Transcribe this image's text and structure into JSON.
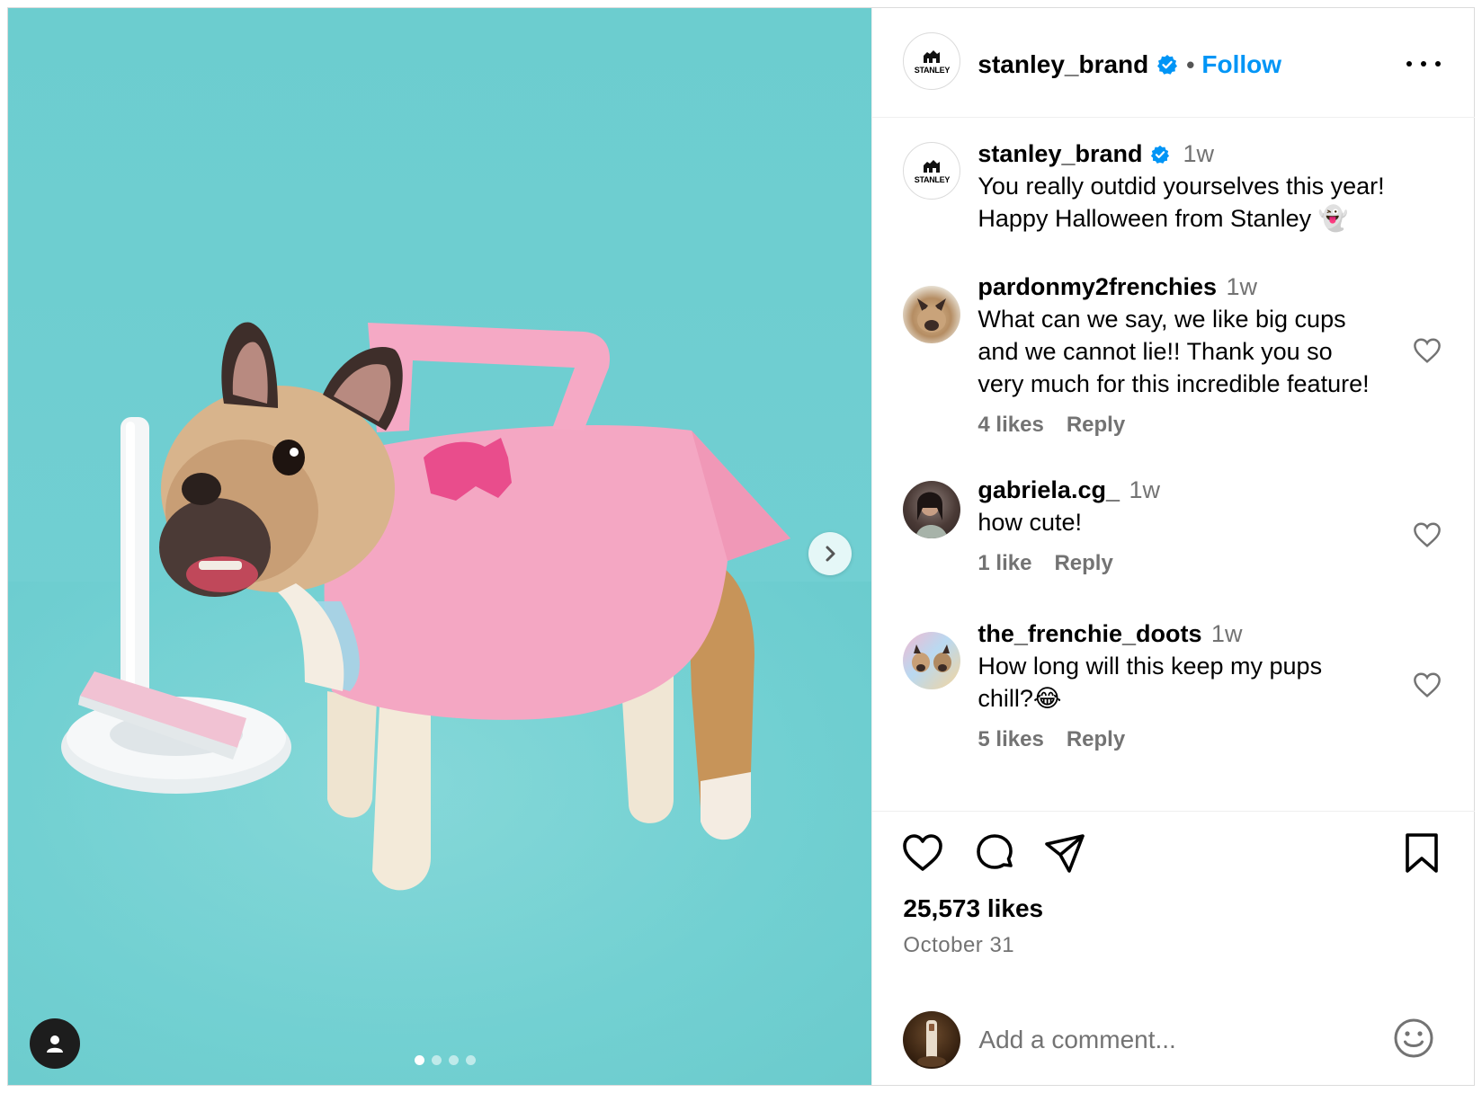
{
  "post": {
    "account": {
      "username": "stanley_brand",
      "verified": true,
      "follow_label": "Follow",
      "dot": "•",
      "avatar_logo_text": "STANLEY"
    },
    "media": {
      "description_icon": "user-tag-icon",
      "carousel_count": 4,
      "carousel_active_index": 0
    },
    "caption": {
      "username": "stanley_brand",
      "time": "1w",
      "line1": "You really outdid yourselves this year!",
      "line2": "Happy Halloween from Stanley 👻"
    },
    "comments": [
      {
        "username": "pardonmy2frenchies",
        "time": "1w",
        "lines": [
          "What can we say, we like big cups",
          "and we cannot lie!! Thank you so",
          "very much for this incredible feature!"
        ],
        "likes": "4 likes",
        "reply": "Reply"
      },
      {
        "username": "gabriela.cg_",
        "time": "1w",
        "lines": [
          "how cute!"
        ],
        "likes": "1 like",
        "reply": "Reply"
      },
      {
        "username": "the_frenchie_doots",
        "time": "1w",
        "lines": [
          "How long will this keep my pups",
          "chill?😂"
        ],
        "likes": "5 likes",
        "reply": "Reply"
      }
    ],
    "likes_total": "25,573 likes",
    "date": "October 31",
    "add_comment": {
      "placeholder": "Add a comment..."
    },
    "colors": {
      "accent": "#0095f6",
      "secondary_text": "#737373",
      "media_background": "#6ccdcf",
      "costume_pink": "#f4a7c3"
    }
  }
}
